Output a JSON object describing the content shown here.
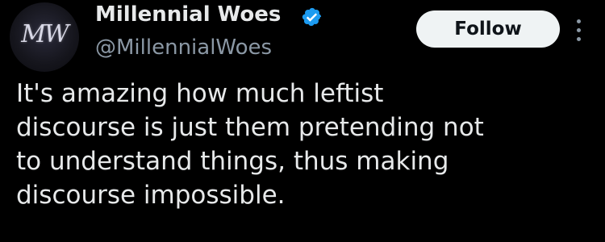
{
  "author": {
    "display_name": "Millennial Woes",
    "handle": "@MillennialWoes",
    "avatar_text": "MW",
    "verified": true,
    "verified_color": "#1d9bf0"
  },
  "actions": {
    "follow_label": "Follow",
    "more_icon": "more-vertical-icon"
  },
  "tweet": {
    "lines": [
      "It's amazing how much leftist",
      "discourse is just them pretending not",
      "to understand things, thus making",
      "discourse impossible."
    ]
  },
  "colors": {
    "background": "#000000",
    "text": "#e7e9ea",
    "secondary_text": "#8b98a5",
    "button_bg": "#eff3f4",
    "button_text": "#0f1419"
  }
}
